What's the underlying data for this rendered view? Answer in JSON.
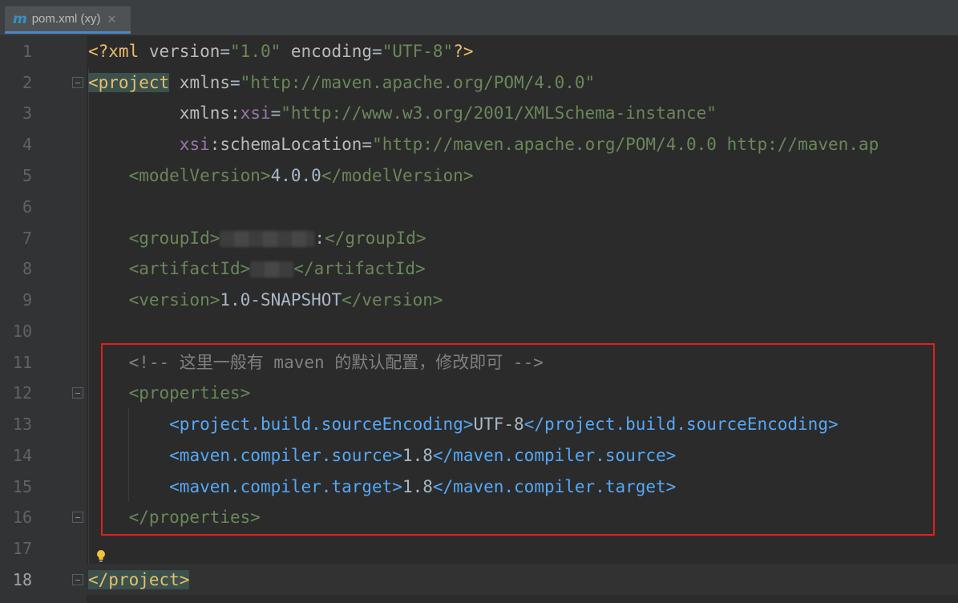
{
  "tab": {
    "icon_letter": "m",
    "label": "pom.xml (xy)",
    "close_symbol": "×"
  },
  "lines": [
    {
      "n": "1"
    },
    {
      "n": "2"
    },
    {
      "n": "3"
    },
    {
      "n": "4"
    },
    {
      "n": "5"
    },
    {
      "n": "6"
    },
    {
      "n": "7"
    },
    {
      "n": "8"
    },
    {
      "n": "9"
    },
    {
      "n": "10"
    },
    {
      "n": "11"
    },
    {
      "n": "12"
    },
    {
      "n": "13"
    },
    {
      "n": "14"
    },
    {
      "n": "15"
    },
    {
      "n": "16"
    },
    {
      "n": "17"
    },
    {
      "n": "18"
    }
  ],
  "code": {
    "l1": {
      "open": "<?xml",
      "version_attr": " version",
      "eq1": "=",
      "version_val": "\"1.0\"",
      "enc_attr": " encoding",
      "eq2": "=",
      "enc_val": "\"UTF-8\"",
      "close": "?>"
    },
    "l2": {
      "open": "<project",
      "attr": " xmlns",
      "eq": "=",
      "val": "\"http://maven.apache.org/POM/4.0.0\""
    },
    "l3": {
      "indent": "         ",
      "attr": "xmlns",
      "colon": ":",
      "ns": "xsi",
      "eq": "=",
      "val": "\"http://www.w3.org/2001/XMLSchema-instance\""
    },
    "l4": {
      "indent": "         ",
      "ns": "xsi",
      "colon": ":",
      "attr": "schemaLocation",
      "eq": "=",
      "val": "\"http://maven.apache.org/POM/4.0.0 http://maven.ap"
    },
    "l5": {
      "indent": "    ",
      "open": "<modelVersion>",
      "text": "4.0.0",
      "close": "</modelVersion>"
    },
    "l7": {
      "indent": "    ",
      "open": "<groupId>",
      "tail": ":",
      "close": "</groupId>"
    },
    "l8": {
      "indent": "    ",
      "open": "<artifactId>",
      "close": "</artifactId>"
    },
    "l9": {
      "indent": "    ",
      "open": "<version>",
      "text": "1.0-SNAPSHOT",
      "close": "</version>"
    },
    "l11": {
      "indent": "    ",
      "comment": "<!-- 这里一般有 maven 的默认配置，修改即可 -->"
    },
    "l12": {
      "indent": "    ",
      "open": "<properties>"
    },
    "l13": {
      "indent": "        ",
      "open": "<project.build.sourceEncoding>",
      "text": "UTF-8",
      "close": "</project.build.sourceEncoding>"
    },
    "l14": {
      "indent": "        ",
      "open": "<maven.compiler.source>",
      "text": "1.8",
      "close": "</maven.compiler.source>"
    },
    "l15": {
      "indent": "        ",
      "open": "<maven.compiler.target>",
      "text": "1.8",
      "close": "</maven.compiler.target>"
    },
    "l16": {
      "indent": "    ",
      "close": "</properties>"
    },
    "l18": {
      "close": "</project>"
    }
  },
  "colors": {
    "accent": "#4a88c7",
    "highlight_box": "#e0201c",
    "tag": "#e8bf6a",
    "string": "#6a8759",
    "comment": "#808080"
  },
  "icons": {
    "file_icon": "maven-file-icon",
    "close": "close-icon",
    "bulb": "lightbulb-icon",
    "fold": "fold-marker-icon"
  }
}
